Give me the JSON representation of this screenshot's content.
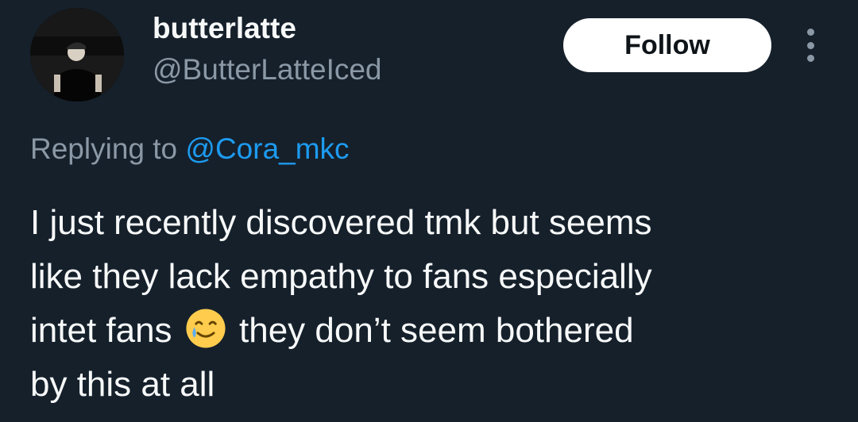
{
  "author": {
    "display_name": "butterlatte",
    "handle": "@ButterLatteIced"
  },
  "actions": {
    "follow_label": "Follow",
    "more_icon": "more-vertical-icon"
  },
  "reply": {
    "prefix": "Replying to ",
    "mention": "@Cora_mkc"
  },
  "tweet": {
    "line1": "I just recently discovered tmk but seems",
    "line2": "like they lack empathy to fans especially",
    "line3_before_emoji": "intet fans",
    "emoji": "smiling-face-with-tear-emoji",
    "line3_after_emoji": "they don’t seem bothered",
    "line4": "by this at all"
  },
  "colors": {
    "background": "#15202b",
    "primary_text": "#f7f9f9",
    "secondary_text": "#8b98a5",
    "link": "#1d9bf0",
    "follow_bg": "#ffffff"
  }
}
